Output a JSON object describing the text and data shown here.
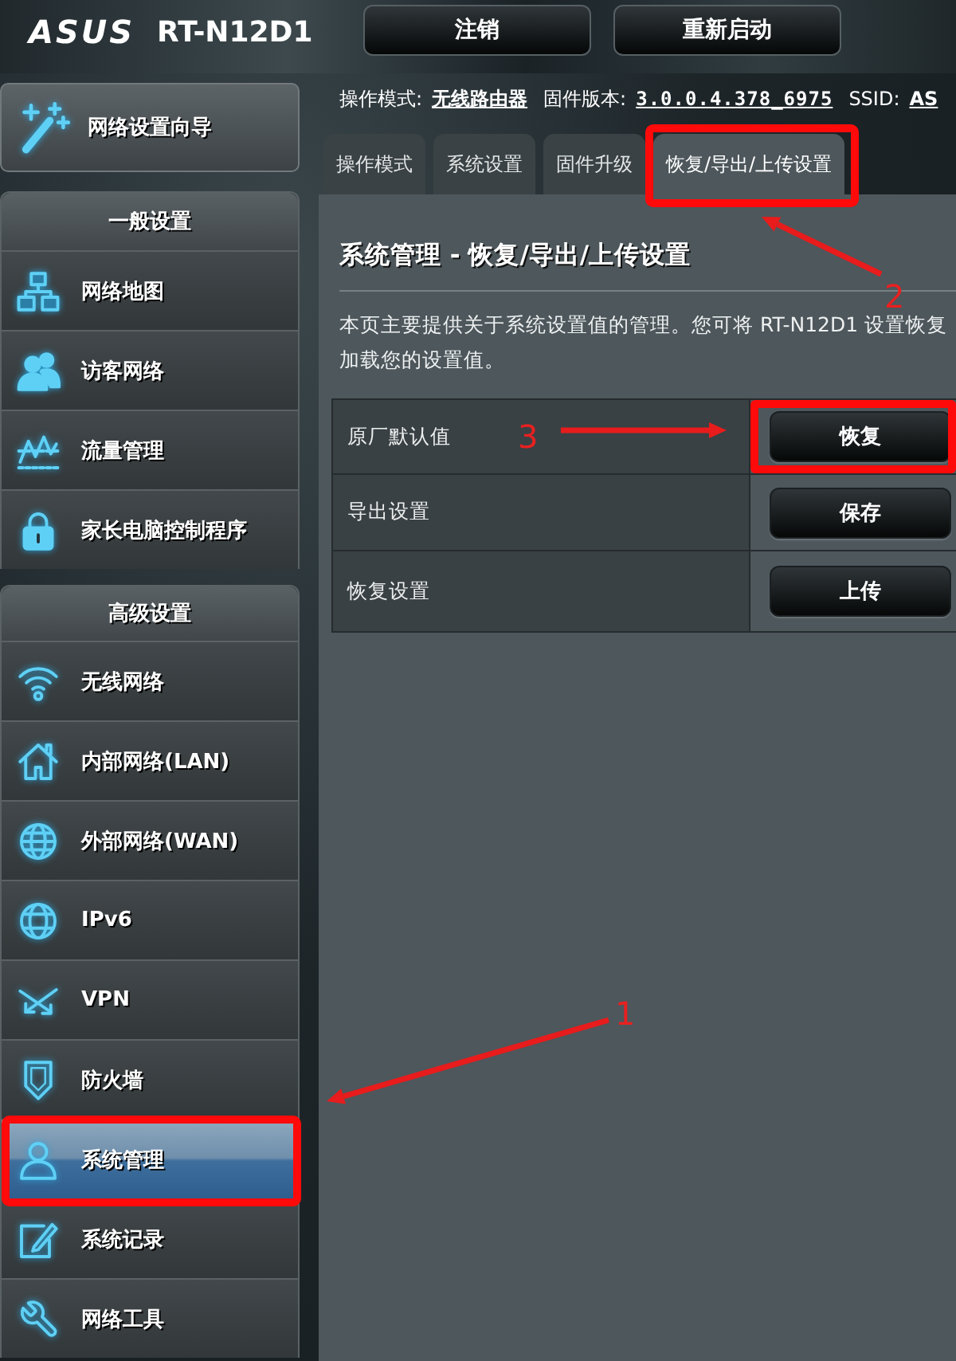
{
  "header": {
    "logo": "ASUS",
    "model": "RT-N12D1",
    "buttons": [
      "注销",
      "重新启动"
    ]
  },
  "status_bar": [
    {
      "label": "操作模式:",
      "value": "无线路由器"
    },
    {
      "label": "固件版本:",
      "value": "3.0.0.4.378_6975"
    },
    {
      "label": "SSID:",
      "value": "AS"
    }
  ],
  "sidebar": {
    "wizard": "网络设置向导",
    "sections": [
      {
        "title": "一般设置",
        "items": [
          {
            "label": "网络地图",
            "selected": false,
            "highlighted": false
          },
          {
            "label": "访客网络",
            "selected": false,
            "highlighted": false
          },
          {
            "label": "流量管理",
            "selected": false,
            "highlighted": false
          },
          {
            "label": "家长电脑控制程序",
            "selected": false,
            "highlighted": false
          }
        ]
      },
      {
        "title": "高级设置",
        "items": [
          {
            "label": "无线网络",
            "selected": false,
            "highlighted": false
          },
          {
            "label": "内部网络(LAN)",
            "selected": false,
            "highlighted": false
          },
          {
            "label": "外部网络(WAN)",
            "selected": false,
            "highlighted": false
          },
          {
            "label": "IPv6",
            "selected": false,
            "highlighted": false
          },
          {
            "label": "VPN",
            "selected": false,
            "highlighted": false
          },
          {
            "label": "防火墙",
            "selected": false,
            "highlighted": false
          },
          {
            "label": "系统管理",
            "selected": true,
            "highlighted": true
          },
          {
            "label": "系统记录",
            "selected": false,
            "highlighted": false
          },
          {
            "label": "网络工具",
            "selected": false,
            "highlighted": false
          }
        ]
      }
    ]
  },
  "tabs": [
    {
      "label": "操作模式",
      "selected": false,
      "highlighted": false
    },
    {
      "label": "系统设置",
      "selected": false,
      "highlighted": false
    },
    {
      "label": "固件升级",
      "selected": false,
      "highlighted": false
    },
    {
      "label": "恢复/导出/上传设置",
      "selected": true,
      "highlighted": true
    }
  ],
  "page": {
    "title": "系统管理 - 恢复/导出/上传设置",
    "description": [
      "本页主要提供关于系统设置值的管理。您可将 RT-N12D1 设置恢复",
      "加载您的设置值。"
    ],
    "rows": [
      {
        "label": "原厂默认值",
        "button": "恢复",
        "highlighted": true
      },
      {
        "label": "导出设置",
        "button": "保存",
        "highlighted": false
      },
      {
        "label": "恢复设置",
        "button": "上传",
        "highlighted": false
      }
    ]
  },
  "annotations": [
    {
      "number": "1"
    },
    {
      "number": "2"
    },
    {
      "number": "3"
    }
  ]
}
